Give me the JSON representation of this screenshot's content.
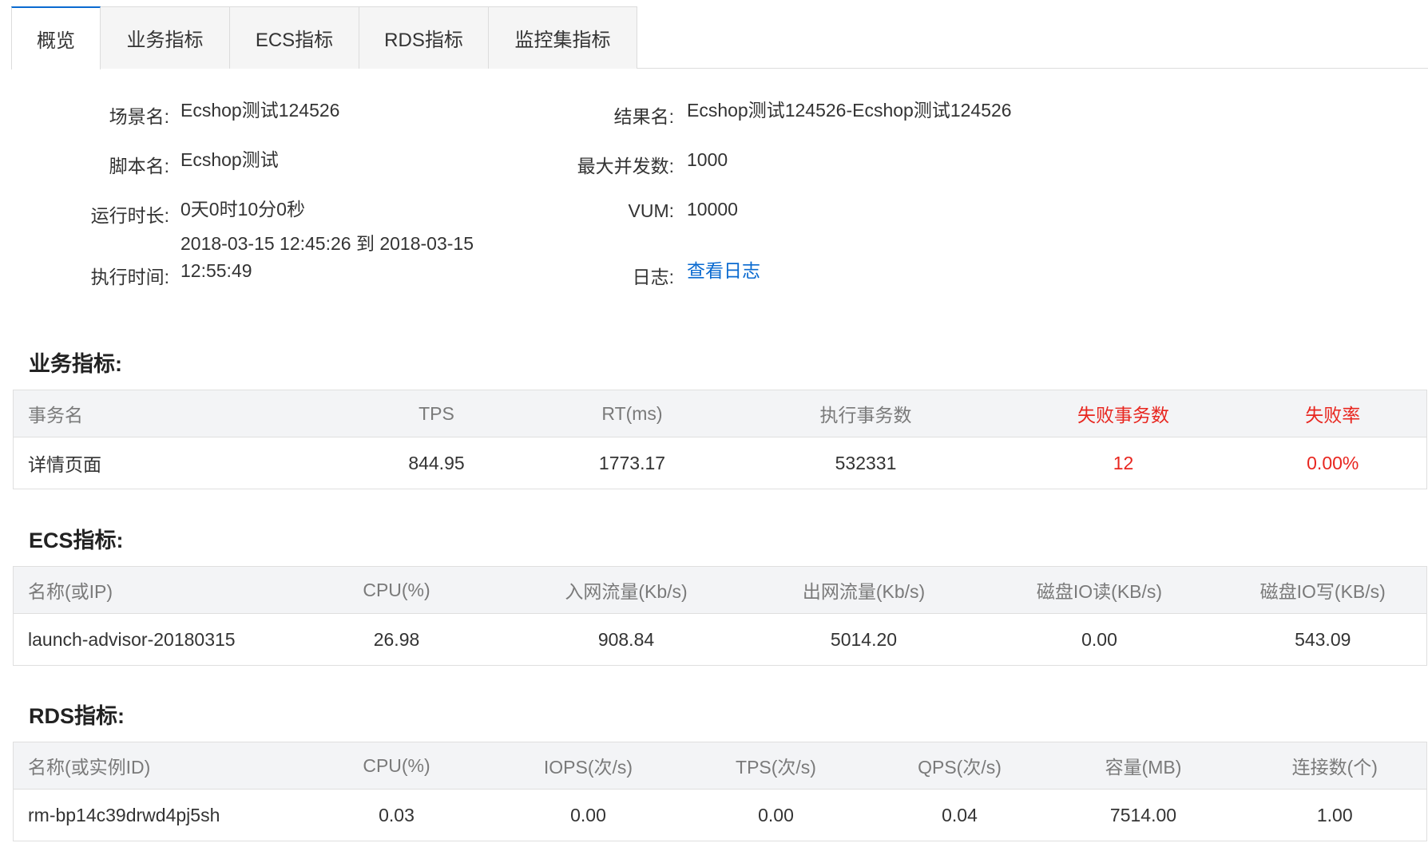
{
  "tabs": [
    {
      "label": "概览",
      "active": true
    },
    {
      "label": "业务指标",
      "active": false
    },
    {
      "label": "ECS指标",
      "active": false
    },
    {
      "label": "RDS指标",
      "active": false
    },
    {
      "label": "监控集指标",
      "active": false
    }
  ],
  "overview": {
    "scene_label": "场景名:",
    "scene_value": "Ecshop测试124526",
    "result_label": "结果名:",
    "result_value": "Ecshop测试124526-Ecshop测试124526",
    "script_label": "脚本名:",
    "script_value": "Ecshop测试",
    "max_concurrency_label": "最大并发数:",
    "max_concurrency_value": "1000",
    "duration_label": "运行时长:",
    "duration_value": "0天0时10分0秒",
    "vum_label": "VUM:",
    "vum_value": "10000",
    "exec_time_label": "执行时间:",
    "exec_time_value": "2018-03-15 12:45:26 到 2018-03-15 12:55:49",
    "log_label": "日志:",
    "log_link": "查看日志"
  },
  "business": {
    "title": "业务指标:",
    "headers": [
      "事务名",
      "TPS",
      "RT(ms)",
      "执行事务数",
      "失败事务数",
      "失败率"
    ],
    "rows": [
      [
        "详情页面",
        "844.95",
        "1773.17",
        "532331",
        "12",
        "0.00%"
      ]
    ]
  },
  "ecs": {
    "title": "ECS指标:",
    "headers": [
      "名称(或IP)",
      "CPU(%)",
      "入网流量(Kb/s)",
      "出网流量(Kb/s)",
      "磁盘IO读(KB/s)",
      "磁盘IO写(KB/s)"
    ],
    "rows": [
      [
        "launch-advisor-20180315",
        "26.98",
        "908.84",
        "5014.20",
        "0.00",
        "543.09"
      ]
    ]
  },
  "rds": {
    "title": "RDS指标:",
    "headers": [
      "名称(或实例ID)",
      "CPU(%)",
      "IOPS(次/s)",
      "TPS(次/s)",
      "QPS(次/s)",
      "容量(MB)",
      "连接数(个)"
    ],
    "rows": [
      [
        "rm-bp14c39drwd4pj5sh",
        "0.03",
        "0.00",
        "0.00",
        "0.04",
        "7514.00",
        "1.00"
      ]
    ]
  },
  "colors": {
    "accent": "#0a6ad0",
    "failure": "#e8261f"
  }
}
